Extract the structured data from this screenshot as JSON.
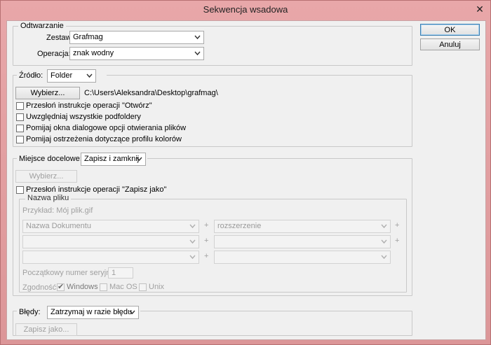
{
  "window": {
    "title": "Sekwencja wsadowa",
    "close_glyph": "✕"
  },
  "buttons": {
    "ok": "OK",
    "cancel": "Anuluj"
  },
  "play": {
    "legend": "Odtwarzanie",
    "set_label": "Zestaw:",
    "set_value": "Grafmag",
    "action_label": "Operacja:",
    "action_value": "znak wodny"
  },
  "source": {
    "label": "Źródło:",
    "value": "Folder",
    "choose_button": "Wybierz...",
    "path": "C:\\Users\\Aleksandra\\Desktop\\grafmag\\",
    "options": [
      {
        "label": "Przesłoń instrukcje operacji \"Otwórz\"",
        "checked": false
      },
      {
        "label": "Uwzględniaj wszystkie podfoldery",
        "checked": false
      },
      {
        "label": "Pomijaj okna dialogowe opcji otwierania plików",
        "checked": false
      },
      {
        "label": "Pomijaj ostrzeżenia dotyczące profilu kolorów",
        "checked": false
      }
    ]
  },
  "destination": {
    "label": "Miejsce docelowe:",
    "value": "Zapisz i zamknij",
    "choose_button": "Wybierz...",
    "override_label": "Przesłoń instrukcje operacji \"Zapisz jako\"",
    "override_checked": false
  },
  "filename": {
    "legend": "Nazwa pliku",
    "example": "Przykład: Mój plik.gif",
    "fields": [
      "Nazwa Dokumentu",
      "rozszerzenie",
      "",
      "",
      "",
      ""
    ],
    "plus": "+",
    "serial_label": "Początkowy numer seryjny:",
    "serial_value": "1",
    "compat_label": "Zgodność:",
    "compat": [
      {
        "label": "Windows",
        "checked": true
      },
      {
        "label": "Mac OS",
        "checked": false
      },
      {
        "label": "Unix",
        "checked": false
      }
    ],
    "check_glyph": "✔"
  },
  "errors": {
    "label": "Błędy:",
    "value": "Zatrzymaj w razie błędu",
    "save_as_button": "Zapisz jako..."
  },
  "icons": {
    "dropdown": "chevron-down-icon",
    "close": "close-icon",
    "check": "check-icon"
  },
  "colors": {
    "titlebar": "#e4a4a6",
    "dialog_bg": "#f0f0f0",
    "default_button_border": "#3c7fb1"
  }
}
